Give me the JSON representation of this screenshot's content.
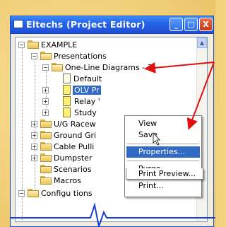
{
  "window": {
    "title": "Eltechs (Project Editor)",
    "minimize_label": "_",
    "maximize_label": "□",
    "close_label": "X"
  },
  "tree": {
    "root": "EXAMPLE",
    "presentations": "Presentations",
    "one_line": "One-Line Diagrams - 3",
    "default": "Default",
    "olv": "OLV Pr",
    "relay": "Relay '",
    "study": "Study",
    "ug": "U/G Racew",
    "ground": "Ground Gri",
    "cable": "Cable Pulli",
    "dumpster": "Dumpster",
    "scenarios": "Scenarios",
    "macros": "Macros",
    "configurations": "Configu    tions",
    "expand_plus": "+",
    "expand_minus": "−"
  },
  "context_menu": {
    "view": "View",
    "save": "Save",
    "properties": "Properties...",
    "purge": "Purge...",
    "print": "Print...",
    "print_preview": "Print Preview..."
  },
  "colors": {
    "annotation_arrow": "#e01010",
    "titlebar": "#2562e8",
    "selection": "#316ac5",
    "pulse_line": "#1a3fd8"
  }
}
